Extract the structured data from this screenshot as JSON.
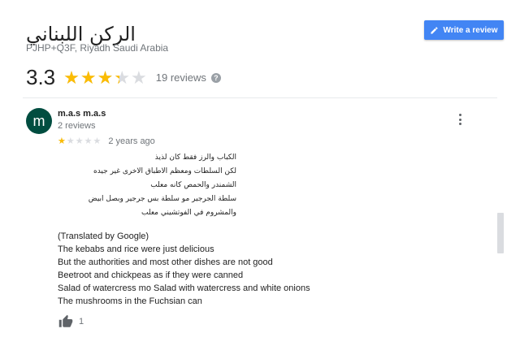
{
  "place": {
    "name": "الركن اللبناني",
    "address": "PJHP+Q3F, Riyadh Saudi Arabia",
    "rating_value": "3.3",
    "rating_fraction": 0.66,
    "review_count": "19 reviews"
  },
  "write_review": {
    "label": "Write a review",
    "color": "#4285f4",
    "icon": "pencil-icon"
  },
  "review": {
    "avatar_letter": "m",
    "avatar_color": "#004d40",
    "author": "m.a.s m.a.s",
    "author_meta": "2 reviews",
    "stars_fraction": 0.2,
    "date": "2 years ago",
    "original_lines": [
      "الكباب والرز فقط كان لذيذ",
      "لكن السلطات ومعظم الاطباق الاخرى غير جيده",
      "الشمندر والحمص كانه معلب",
      "سلطة الجرجير مو سلطة بس جرجير وبصل ابيض",
      "والمشروم في الفوتشيني معلب"
    ],
    "translated_lines": [
      "(Translated by Google)",
      "The kebabs and rice were just delicious",
      "But the authorities and most other dishes are not good",
      "Beetroot and chickpeas as if they were canned",
      "Salad of watercress mo Salad with watercress and white onions",
      "The mushrooms in the Fuchsian can"
    ],
    "likes": "1"
  },
  "colors": {
    "star": "#fbbc04",
    "star_empty": "#dadce0"
  }
}
